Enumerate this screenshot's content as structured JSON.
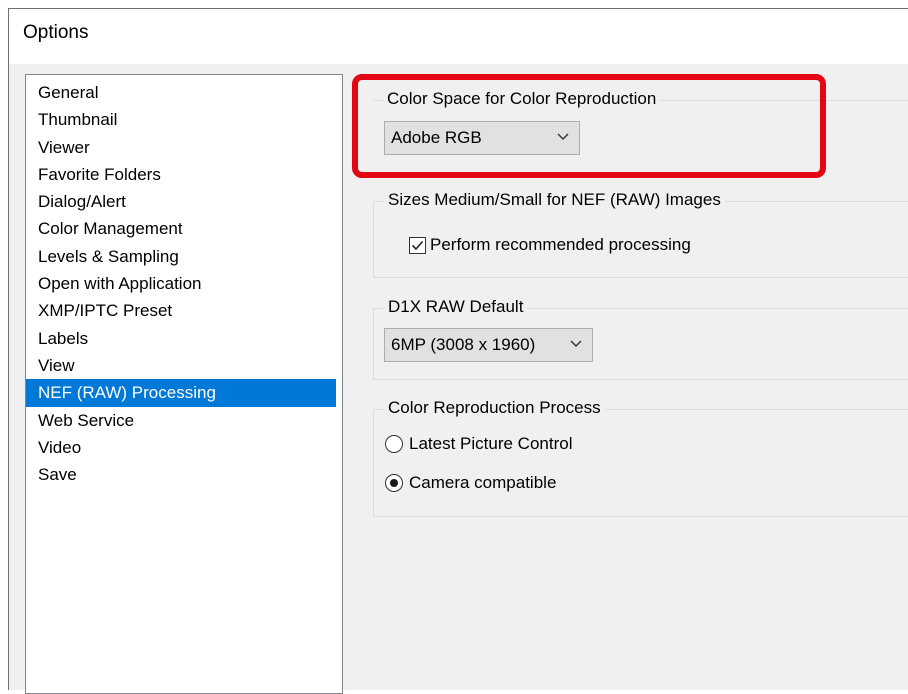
{
  "window": {
    "title": "Options"
  },
  "sidebar": {
    "items": [
      {
        "label": "General",
        "selected": false
      },
      {
        "label": "Thumbnail",
        "selected": false
      },
      {
        "label": "Viewer",
        "selected": false
      },
      {
        "label": "Favorite Folders",
        "selected": false
      },
      {
        "label": "Dialog/Alert",
        "selected": false
      },
      {
        "label": "Color Management",
        "selected": false
      },
      {
        "label": "Levels & Sampling",
        "selected": false
      },
      {
        "label": "Open with Application",
        "selected": false
      },
      {
        "label": "XMP/IPTC Preset",
        "selected": false
      },
      {
        "label": "Labels",
        "selected": false
      },
      {
        "label": "View",
        "selected": false
      },
      {
        "label": "NEF (RAW) Processing",
        "selected": true
      },
      {
        "label": "Web Service",
        "selected": false
      },
      {
        "label": "Video",
        "selected": false
      },
      {
        "label": "Save",
        "selected": false
      }
    ]
  },
  "color_space": {
    "caption": "Color Space for Color Reproduction",
    "selected_value": "Adobe RGB"
  },
  "sizes": {
    "caption": "Sizes Medium/Small for NEF (RAW) Images",
    "checkbox_label": "Perform recommended processing",
    "checked": true
  },
  "d1x": {
    "caption": "D1X RAW Default",
    "selected_value": "6MP (3008 x 1960)"
  },
  "reproduction": {
    "caption": "Color Reproduction Process",
    "options": [
      {
        "label": "Latest Picture Control",
        "selected": false
      },
      {
        "label": "Camera compatible",
        "selected": true
      }
    ]
  },
  "colors": {
    "selection": "#0078d7",
    "highlight": "#e30613",
    "panel_bg": "#f0f0f0"
  }
}
